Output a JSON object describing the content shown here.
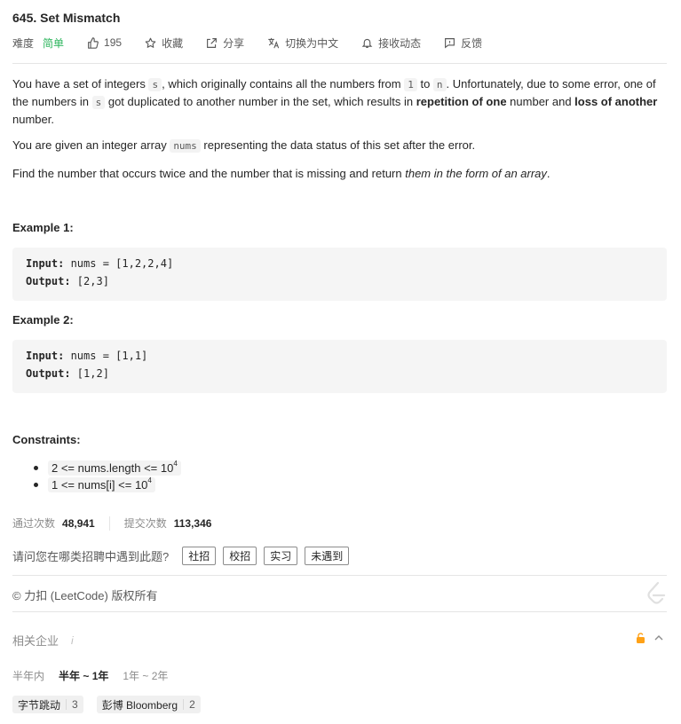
{
  "problem": {
    "title": "645. Set Mismatch",
    "difficulty_label": "难度",
    "difficulty": "简单",
    "likes": "195",
    "favorite_label": "收藏",
    "share_label": "分享",
    "switch_lang_label": "切换为中文",
    "subscribe_label": "接收动态",
    "feedback_label": "反馈"
  },
  "description": {
    "p1_a": "You have a set of integers ",
    "p1_code_s": "s",
    "p1_b": ", which originally contains all the numbers from ",
    "p1_code_1": "1",
    "p1_c": " to ",
    "p1_code_n": "n",
    "p1_d": ". Unfortunately, due to some error, one of the numbers in ",
    "p1_code_s2": "s",
    "p1_e": " got duplicated to another number in the set, which results in ",
    "p1_bold1": "repetition of one",
    "p1_f": " number and ",
    "p1_bold2": "loss of another",
    "p1_g": " number.",
    "p2_a": "You are given an integer array ",
    "p2_code": "nums",
    "p2_b": " representing the data status of this set after the error.",
    "p3_a": "Find the number that occurs twice and the number that is missing and return ",
    "p3_em": "them in the form of an array",
    "p3_b": "."
  },
  "examples": [
    {
      "heading": "Example 1:",
      "input_label": "Input:",
      "input": " nums = [1,2,2,4]",
      "output_label": "Output:",
      "output": " [2,3]"
    },
    {
      "heading": "Example 2:",
      "input_label": "Input:",
      "input": " nums = [1,1]",
      "output_label": "Output:",
      "output": " [1,2]"
    }
  ],
  "constraints": {
    "heading": "Constraints:",
    "items": [
      {
        "text": "2 <= nums.length <= 10",
        "sup": "4"
      },
      {
        "text": "1 <= nums[i] <= 10",
        "sup": "4"
      }
    ]
  },
  "stats": {
    "accepted_label": "通过次数",
    "accepted": "48,941",
    "submissions_label": "提交次数",
    "submissions": "113,346"
  },
  "survey": {
    "question": "请问您在哪类招聘中遇到此题?",
    "options": [
      "社招",
      "校招",
      "实习",
      "未遇到"
    ]
  },
  "footer": {
    "copyright": "© 力扣 (LeetCode) 版权所有"
  },
  "companies": {
    "heading": "相关企业",
    "info": "i",
    "filters": [
      "半年内",
      "半年 ~ 1年",
      "1年 ~ 2年"
    ],
    "active_filter_index": 1,
    "tags": [
      {
        "name": "字节跳动",
        "count": "3"
      },
      {
        "name": "彭博 Bloomberg",
        "count": "2"
      }
    ]
  },
  "colors": {
    "difficulty_easy": "#2db55d",
    "lock_icon": "#ffa116"
  }
}
